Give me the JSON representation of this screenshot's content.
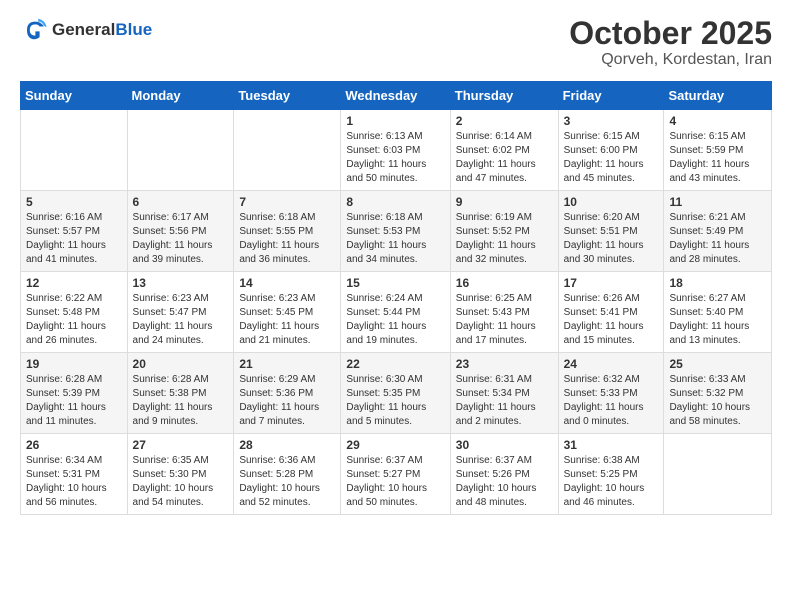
{
  "header": {
    "logo_line1": "General",
    "logo_line2": "Blue",
    "month": "October 2025",
    "location": "Qorveh, Kordestan, Iran"
  },
  "weekdays": [
    "Sunday",
    "Monday",
    "Tuesday",
    "Wednesday",
    "Thursday",
    "Friday",
    "Saturday"
  ],
  "weeks": [
    [
      {
        "day": "",
        "info": ""
      },
      {
        "day": "",
        "info": ""
      },
      {
        "day": "",
        "info": ""
      },
      {
        "day": "1",
        "info": "Sunrise: 6:13 AM\nSunset: 6:03 PM\nDaylight: 11 hours\nand 50 minutes."
      },
      {
        "day": "2",
        "info": "Sunrise: 6:14 AM\nSunset: 6:02 PM\nDaylight: 11 hours\nand 47 minutes."
      },
      {
        "day": "3",
        "info": "Sunrise: 6:15 AM\nSunset: 6:00 PM\nDaylight: 11 hours\nand 45 minutes."
      },
      {
        "day": "4",
        "info": "Sunrise: 6:15 AM\nSunset: 5:59 PM\nDaylight: 11 hours\nand 43 minutes."
      }
    ],
    [
      {
        "day": "5",
        "info": "Sunrise: 6:16 AM\nSunset: 5:57 PM\nDaylight: 11 hours\nand 41 minutes."
      },
      {
        "day": "6",
        "info": "Sunrise: 6:17 AM\nSunset: 5:56 PM\nDaylight: 11 hours\nand 39 minutes."
      },
      {
        "day": "7",
        "info": "Sunrise: 6:18 AM\nSunset: 5:55 PM\nDaylight: 11 hours\nand 36 minutes."
      },
      {
        "day": "8",
        "info": "Sunrise: 6:18 AM\nSunset: 5:53 PM\nDaylight: 11 hours\nand 34 minutes."
      },
      {
        "day": "9",
        "info": "Sunrise: 6:19 AM\nSunset: 5:52 PM\nDaylight: 11 hours\nand 32 minutes."
      },
      {
        "day": "10",
        "info": "Sunrise: 6:20 AM\nSunset: 5:51 PM\nDaylight: 11 hours\nand 30 minutes."
      },
      {
        "day": "11",
        "info": "Sunrise: 6:21 AM\nSunset: 5:49 PM\nDaylight: 11 hours\nand 28 minutes."
      }
    ],
    [
      {
        "day": "12",
        "info": "Sunrise: 6:22 AM\nSunset: 5:48 PM\nDaylight: 11 hours\nand 26 minutes."
      },
      {
        "day": "13",
        "info": "Sunrise: 6:23 AM\nSunset: 5:47 PM\nDaylight: 11 hours\nand 24 minutes."
      },
      {
        "day": "14",
        "info": "Sunrise: 6:23 AM\nSunset: 5:45 PM\nDaylight: 11 hours\nand 21 minutes."
      },
      {
        "day": "15",
        "info": "Sunrise: 6:24 AM\nSunset: 5:44 PM\nDaylight: 11 hours\nand 19 minutes."
      },
      {
        "day": "16",
        "info": "Sunrise: 6:25 AM\nSunset: 5:43 PM\nDaylight: 11 hours\nand 17 minutes."
      },
      {
        "day": "17",
        "info": "Sunrise: 6:26 AM\nSunset: 5:41 PM\nDaylight: 11 hours\nand 15 minutes."
      },
      {
        "day": "18",
        "info": "Sunrise: 6:27 AM\nSunset: 5:40 PM\nDaylight: 11 hours\nand 13 minutes."
      }
    ],
    [
      {
        "day": "19",
        "info": "Sunrise: 6:28 AM\nSunset: 5:39 PM\nDaylight: 11 hours\nand 11 minutes."
      },
      {
        "day": "20",
        "info": "Sunrise: 6:28 AM\nSunset: 5:38 PM\nDaylight: 11 hours\nand 9 minutes."
      },
      {
        "day": "21",
        "info": "Sunrise: 6:29 AM\nSunset: 5:36 PM\nDaylight: 11 hours\nand 7 minutes."
      },
      {
        "day": "22",
        "info": "Sunrise: 6:30 AM\nSunset: 5:35 PM\nDaylight: 11 hours\nand 5 minutes."
      },
      {
        "day": "23",
        "info": "Sunrise: 6:31 AM\nSunset: 5:34 PM\nDaylight: 11 hours\nand 2 minutes."
      },
      {
        "day": "24",
        "info": "Sunrise: 6:32 AM\nSunset: 5:33 PM\nDaylight: 11 hours\nand 0 minutes."
      },
      {
        "day": "25",
        "info": "Sunrise: 6:33 AM\nSunset: 5:32 PM\nDaylight: 10 hours\nand 58 minutes."
      }
    ],
    [
      {
        "day": "26",
        "info": "Sunrise: 6:34 AM\nSunset: 5:31 PM\nDaylight: 10 hours\nand 56 minutes."
      },
      {
        "day": "27",
        "info": "Sunrise: 6:35 AM\nSunset: 5:30 PM\nDaylight: 10 hours\nand 54 minutes."
      },
      {
        "day": "28",
        "info": "Sunrise: 6:36 AM\nSunset: 5:28 PM\nDaylight: 10 hours\nand 52 minutes."
      },
      {
        "day": "29",
        "info": "Sunrise: 6:37 AM\nSunset: 5:27 PM\nDaylight: 10 hours\nand 50 minutes."
      },
      {
        "day": "30",
        "info": "Sunrise: 6:37 AM\nSunset: 5:26 PM\nDaylight: 10 hours\nand 48 minutes."
      },
      {
        "day": "31",
        "info": "Sunrise: 6:38 AM\nSunset: 5:25 PM\nDaylight: 10 hours\nand 46 minutes."
      },
      {
        "day": "",
        "info": ""
      }
    ]
  ]
}
